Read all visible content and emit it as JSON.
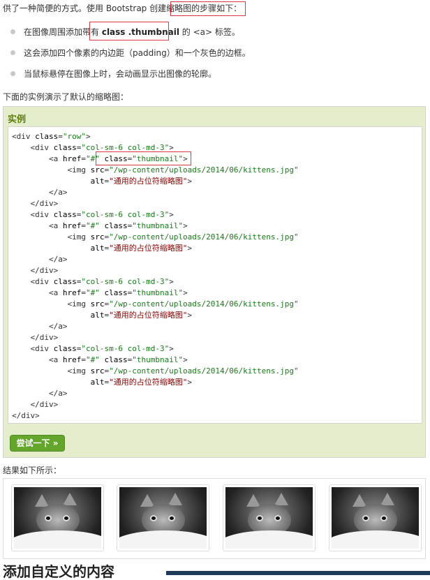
{
  "intro": "供了一种简便的方式。使用 Bootstrap 创建缩略图的步骤如下：",
  "steps": [
    {
      "before": "在图像周围添加带有 ",
      "kw": "class .thumbnail",
      "after": " 的 <a> 标签。"
    },
    {
      "text": "这会添加四个像素的内边距（padding）和一个灰色的边框。"
    },
    {
      "text": "当鼠标悬停在图像上时，会动画显示出图像的轮廓。"
    }
  ],
  "description": "下面的实例演示了默认的缩略图：",
  "example_title": "实例",
  "code_lines": [
    "<div class=\"row\">",
    "    <div class=\"col-sm-6 col-md-3\">",
    "        <a href=\"#\" class=\"thumbnail\">",
    "            <img src=\"/wp-content/uploads/2014/06/kittens.jpg\"",
    "                 alt=\"通用的占位符缩略图\">",
    "        </a>",
    "    </div>",
    "    <div class=\"col-sm-6 col-md-3\">",
    "        <a href=\"#\" class=\"thumbnail\">",
    "            <img src=\"/wp-content/uploads/2014/06/kittens.jpg\"",
    "                 alt=\"通用的占位符缩略图\">",
    "        </a>",
    "    </div>",
    "    <div class=\"col-sm-6 col-md-3\">",
    "        <a href=\"#\" class=\"thumbnail\">",
    "            <img src=\"/wp-content/uploads/2014/06/kittens.jpg\"",
    "                 alt=\"通用的占位符缩略图\">",
    "        </a>",
    "    </div>",
    "    <div class=\"col-sm-6 col-md-3\">",
    "        <a href=\"#\" class=\"thumbnail\">",
    "            <img src=\"/wp-content/uploads/2014/06/kittens.jpg\"",
    "                 alt=\"通用的占位符缩略图\">",
    "        </a>",
    "    </div>",
    "</div>"
  ],
  "try_button": "尝试一下 »",
  "result_label": "结果如下所示：",
  "thumbnails": [
    {
      "icon": "kitten-image"
    },
    {
      "icon": "kitten-image"
    },
    {
      "icon": "kitten-image"
    },
    {
      "icon": "kitten-image"
    }
  ],
  "next_heading": "添加自定义的内容",
  "colors": {
    "example_bg": "#e5eecc",
    "example_title": "#617f10",
    "button_bg": "#64a52c",
    "highlight_border": "#d9363e",
    "attr_value": "#1a7a1a",
    "string_value": "#8b0000"
  }
}
